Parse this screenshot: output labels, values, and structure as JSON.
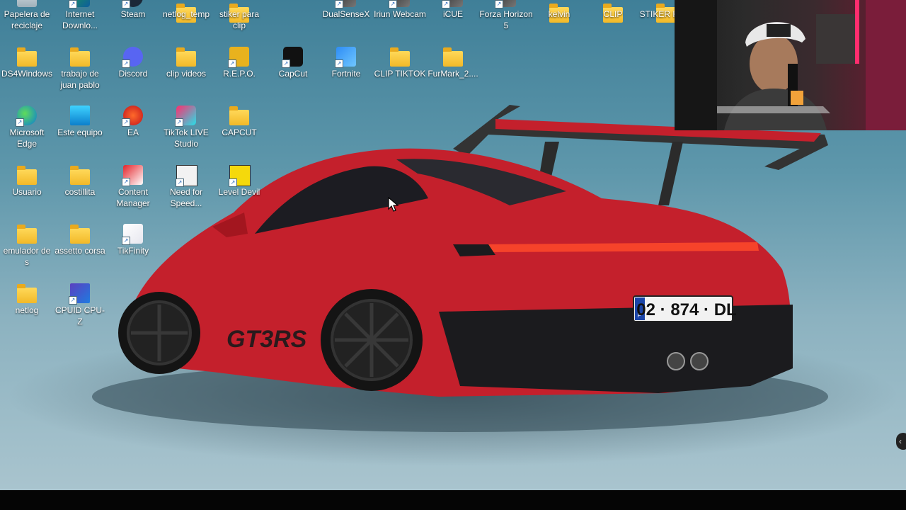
{
  "desktop_icons": [
    {
      "label": "Papelera de reciclaje"
    },
    {
      "label": "Internet Downlo..."
    },
    {
      "label": "Steam"
    },
    {
      "label": "netlog_temp"
    },
    {
      "label": "stiker para clip"
    },
    {
      "label": "DualSenseX"
    },
    {
      "label": "Iriun Webcam"
    },
    {
      "label": "iCUE"
    },
    {
      "label": "Forza Horizon 5"
    },
    {
      "label": "kelvin"
    },
    {
      "label": "CLIP"
    },
    {
      "label": "STIKER KICK"
    },
    {
      "label": "DS4Windows"
    },
    {
      "label": "trabajo de juan pablo"
    },
    {
      "label": "Discord"
    },
    {
      "label": "clip videos"
    },
    {
      "label": "R.E.P.O."
    },
    {
      "label": "CapCut"
    },
    {
      "label": "Fortnite"
    },
    {
      "label": "CLIP TIKTOK"
    },
    {
      "label": "FurMark_2...."
    },
    {
      "label": "Microsoft Edge"
    },
    {
      "label": "Este equipo"
    },
    {
      "label": "EA"
    },
    {
      "label": "TikTok LIVE Studio"
    },
    {
      "label": "CAPCUT"
    },
    {
      "label": "Usuario"
    },
    {
      "label": "costillita"
    },
    {
      "label": "Content Manager"
    },
    {
      "label": "Need for Speed..."
    },
    {
      "label": "Level Devil"
    },
    {
      "label": "emulador de s"
    },
    {
      "label": "assetto corsa"
    },
    {
      "label": "TikFinity"
    },
    {
      "label": "netlog"
    },
    {
      "label": "CPUID CPU-Z"
    }
  ],
  "wallpaper": {
    "plate_text": "02 · 874 · DL",
    "plate_country": "F",
    "badge_text": "GT3RS",
    "body_color": "#c4202c"
  },
  "scroll_arrow": "‹"
}
